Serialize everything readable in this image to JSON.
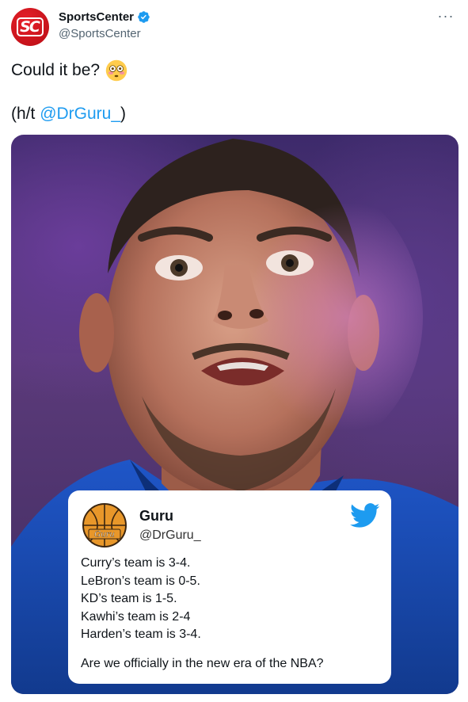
{
  "account": {
    "display_name": "SportsCenter",
    "handle": "@SportsCenter",
    "avatar_text": "SC",
    "verified": true
  },
  "tweet": {
    "line1": "Could it be?",
    "emoji": "flushed-face",
    "ht_prefix": "(h/t ",
    "mention": "@DrGuru_",
    "ht_suffix": ")"
  },
  "quoted_card": {
    "name": "Guru",
    "handle": "@DrGuru_",
    "avatar_text": "Guru",
    "lines": [
      "Curry’s team is 3-4.",
      "LeBron’s team is 0-5.",
      "KD’s team is 1-5.",
      "Kawhi’s team is 2-4",
      "Harden’s team is 3-4."
    ],
    "question": "Are we officially in the new era of the NBA?"
  },
  "colors": {
    "link": "#1d9bf0",
    "brand_red": "#d0161f",
    "verified_blue": "#1d9bf0",
    "twitter_blue": "#1d9bf0"
  }
}
